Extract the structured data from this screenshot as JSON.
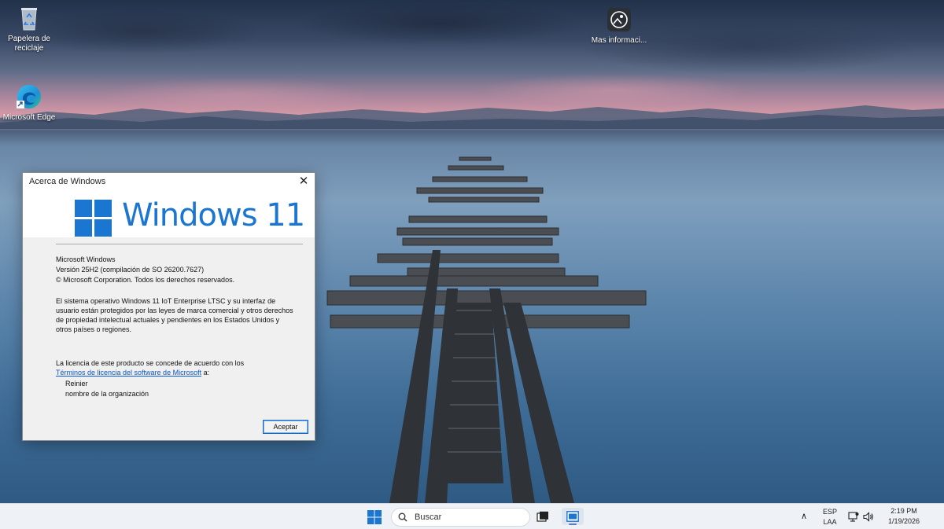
{
  "desktop": {
    "icons": [
      {
        "label": "Papelera de reciclaje",
        "icon": "recycle-bin-icon"
      },
      {
        "label": "Microsoft Edge",
        "icon": "edge-icon"
      },
      {
        "label": "Mas informaci...",
        "icon": "learn-about-picture-icon"
      }
    ]
  },
  "dialog": {
    "title": "Acerca de Windows",
    "close_glyph": "✕",
    "logo_text": "Windows 11",
    "product": "Microsoft Windows",
    "version": "Versión 25H2 (compilación de SO 26200.7627)",
    "copyright": "© Microsoft Corporation. Todos los derechos reservados.",
    "legal_1": "El sistema operativo Windows 11 IoT Enterprise LTSC y su interfaz de",
    "legal_2": "usuario están protegidos por las leyes de marca comercial y otros derechos",
    "legal_3": "de propiedad intelectual actuales y pendientes en los Estados Unidos y",
    "legal_4": "otros países o regiones.",
    "license_intro": "La licencia de este producto se concede de acuerdo con los",
    "license_link": "Términos de licencia del software de Microsoft",
    "license_suffix": " a:",
    "user": "Reinier",
    "organization": "nombre de la organización",
    "ok_label": "Aceptar",
    "accent": "#1b76d1"
  },
  "taskbar": {
    "search_placeholder": "Buscar",
    "language_top": "ESP",
    "language_bottom": "LAA",
    "time": "2:19 PM",
    "date": "1/19/2026",
    "chevron_glyph": "∧",
    "icons": [
      "start-icon",
      "search-icon",
      "task-view-icon",
      "app-window-icon",
      "chevron-up-icon",
      "network-icon",
      "volume-icon"
    ]
  }
}
